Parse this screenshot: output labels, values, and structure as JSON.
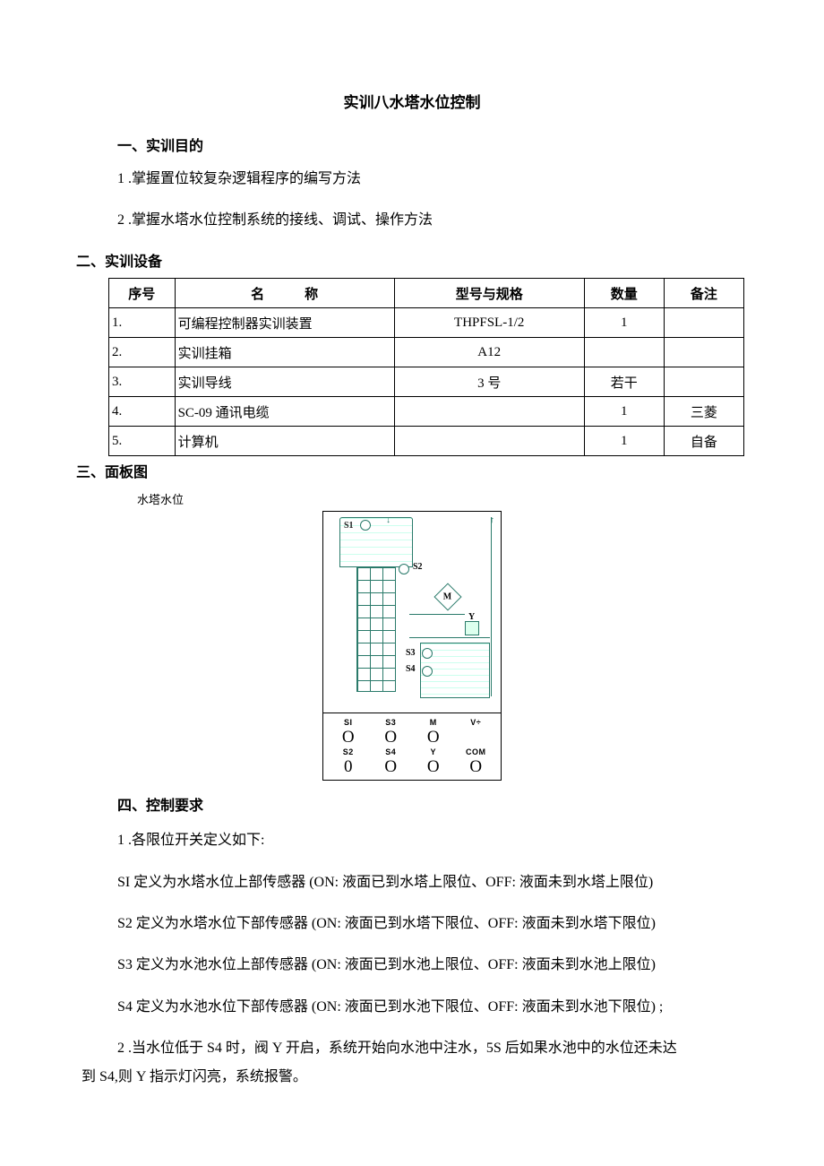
{
  "title": "实训八水塔水位控制",
  "section1": {
    "heading": "一、实训目的",
    "items": [
      "1 .掌握置位较复杂逻辑程序的编写方法",
      "2 .掌握水塔水位控制系统的接线、调试、操作方法"
    ]
  },
  "section2": {
    "heading": "二、实训设备",
    "headers": {
      "seq": "序号",
      "name": "名　　　称",
      "model": "型号与规格",
      "qty": "数量",
      "note": "备注"
    },
    "rows": [
      {
        "seq": "1.",
        "name": "可编程控制器实训装置",
        "model": "THPFSL-1/2",
        "qty": "1",
        "note": ""
      },
      {
        "seq": "2.",
        "name": "实训挂箱",
        "model": "A12",
        "qty": "",
        "note": ""
      },
      {
        "seq": "3.",
        "name": "实训导线",
        "model": "3 号",
        "qty": "若干",
        "note": ""
      },
      {
        "seq": "4.",
        "name": "SC-09 通讯电缆",
        "model": "",
        "qty": "1",
        "note": "三菱"
      },
      {
        "seq": "5.",
        "name": "计算机",
        "model": "",
        "qty": "1",
        "note": "自备"
      }
    ]
  },
  "section3": {
    "heading": "三、面板图",
    "caption": "水塔水位",
    "diagram": {
      "S1": "S1",
      "S2": "S2",
      "S3": "S3",
      "S4": "S4",
      "M": "M",
      "Y": "Y"
    },
    "terminals_row1": [
      "SI",
      "S3",
      "M",
      "V÷"
    ],
    "terminals_row1_o": [
      "O",
      "O",
      "O",
      ""
    ],
    "terminals_row2": [
      "S2",
      "S4",
      "Y",
      "COM"
    ],
    "terminals_row2_o": [
      "0",
      "O",
      "O",
      "O"
    ]
  },
  "section4": {
    "heading": "四、控制要求",
    "lines": [
      "1 .各限位开关定义如下:",
      "SI 定义为水塔水位上部传感器 (ON: 液面已到水塔上限位、OFF: 液面未到水塔上限位)",
      "S2 定义为水塔水位下部传感器 (ON: 液面已到水塔下限位、OFF: 液面未到水塔下限位)",
      "S3 定义为水池水位上部传感器 (ON: 液面已到水池上限位、OFF: 液面未到水池上限位)",
      "S4 定义为水池水位下部传感器 (ON: 液面已到水池下限位、OFF: 液面未到水池下限位) ;"
    ],
    "line_wrap_a": "2 .当水位低于 S4 时，阀 Y 开启，系统开始向水池中注水，5S 后如果水池中的水位还未达",
    "line_wrap_b": "到 S4,则 Y 指示灯闪亮，系统报警。"
  }
}
